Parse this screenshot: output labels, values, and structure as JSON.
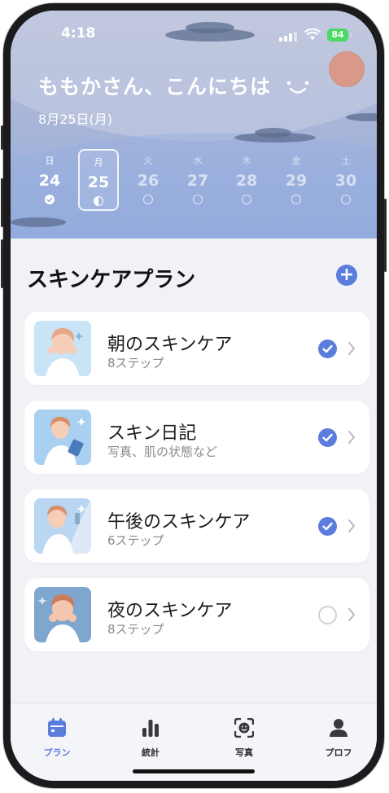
{
  "status_bar": {
    "time": "4:18",
    "battery": "84"
  },
  "header": {
    "greeting": "ももかさん、こんにちは",
    "date": "8月25日(月)",
    "week": [
      {
        "weekday": "日",
        "day": "24",
        "state": "done"
      },
      {
        "weekday": "月",
        "day": "25",
        "state": "half",
        "selected": true
      },
      {
        "weekday": "火",
        "day": "26",
        "state": "empty"
      },
      {
        "weekday": "水",
        "day": "27",
        "state": "empty"
      },
      {
        "weekday": "木",
        "day": "28",
        "state": "empty"
      },
      {
        "weekday": "金",
        "day": "29",
        "state": "empty"
      },
      {
        "weekday": "土",
        "day": "30",
        "state": "empty"
      }
    ]
  },
  "plan": {
    "title": "スキンケアプラン",
    "items": [
      {
        "title": "朝のスキンケア",
        "subtitle": "8ステップ",
        "completed": true
      },
      {
        "title": "スキン日記",
        "subtitle": "写真、肌の状態など",
        "completed": true
      },
      {
        "title": "午後のスキンケア",
        "subtitle": "6ステップ",
        "completed": true
      },
      {
        "title": "夜のスキンケア",
        "subtitle": "8ステップ",
        "completed": false
      }
    ]
  },
  "tabs": [
    {
      "label": "プラン",
      "icon": "calendar-icon",
      "active": true
    },
    {
      "label": "統計",
      "icon": "bar-chart-icon",
      "active": false
    },
    {
      "label": "写真",
      "icon": "face-scan-icon",
      "active": false
    },
    {
      "label": "プロフ",
      "icon": "person-icon",
      "active": false
    }
  ],
  "colors": {
    "accent": "#5b7ddd",
    "hero_top": "#b7c0db",
    "hero_bottom": "#8fa9db",
    "avatar": "#d9998a"
  }
}
